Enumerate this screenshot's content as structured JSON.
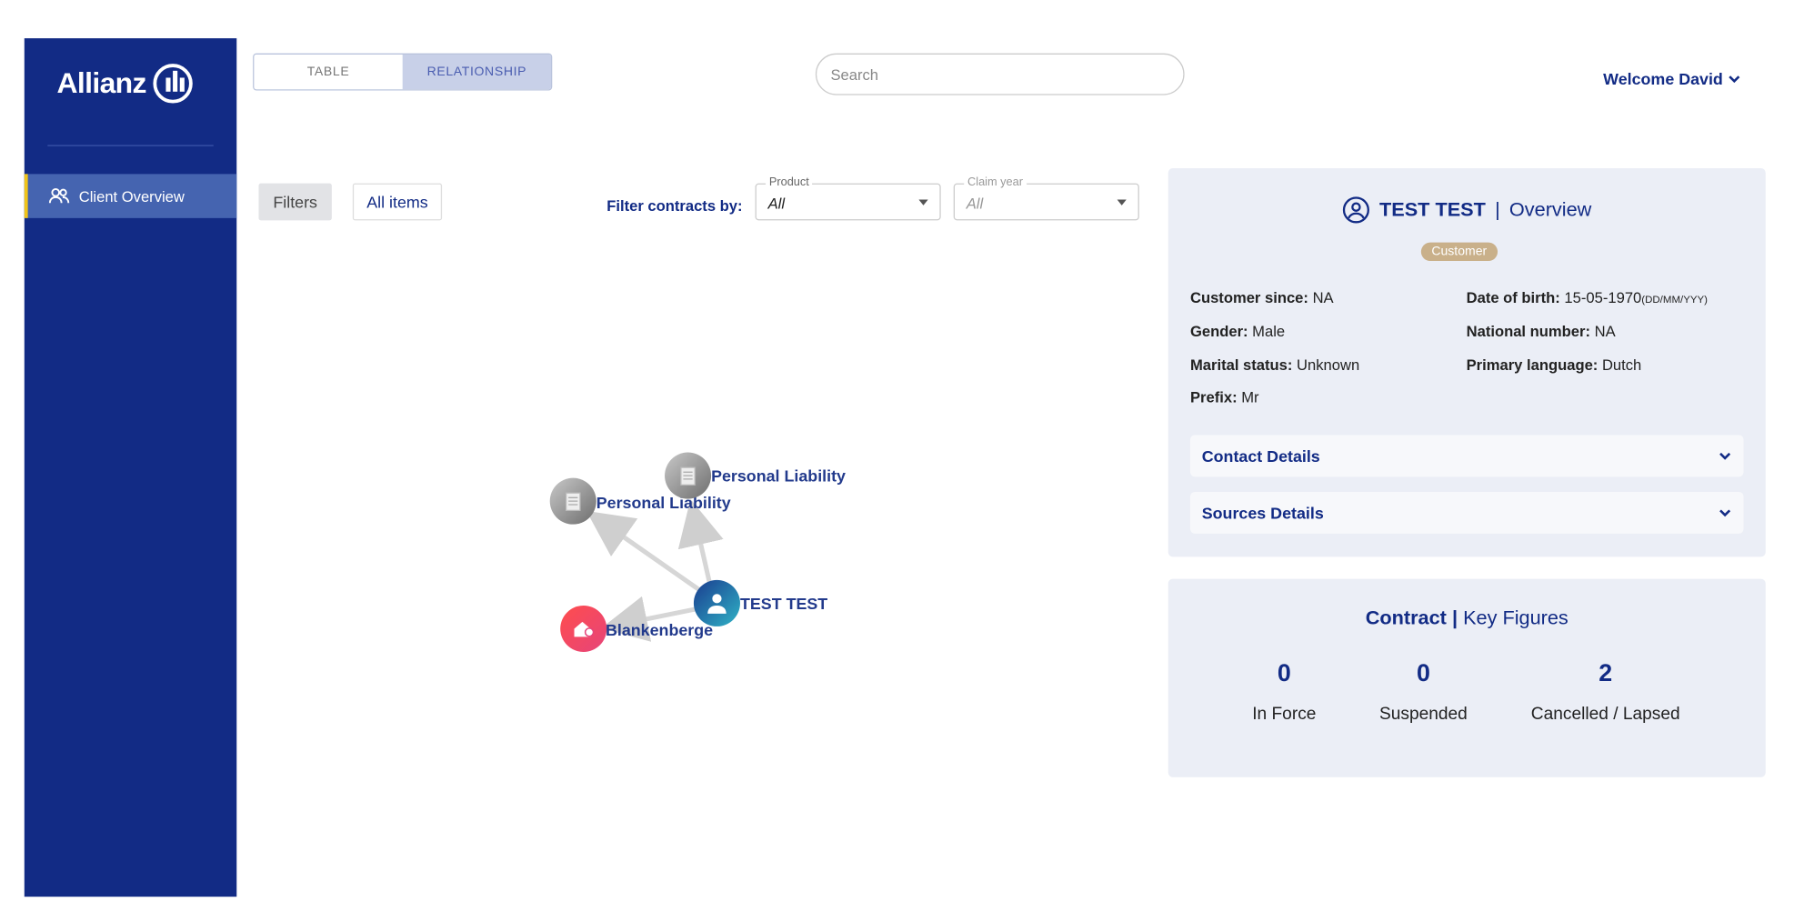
{
  "brand": {
    "name": "Allianz"
  },
  "sidebar": {
    "items": [
      {
        "label": "Client Overview",
        "icon": "users-icon"
      }
    ]
  },
  "view_tabs": [
    {
      "label": "TABLE",
      "active": false
    },
    {
      "label": "RELATIONSHIP",
      "active": true
    }
  ],
  "search": {
    "placeholder": "Search",
    "value": ""
  },
  "user_menu": {
    "label": "Welcome David"
  },
  "filters": {
    "filters_button": "Filters",
    "all_items_button": "All items",
    "filter_by_label": "Filter contracts by:",
    "product": {
      "label": "Product",
      "value": "All"
    },
    "claim_year": {
      "label": "Claim year",
      "value": "All"
    }
  },
  "graph": {
    "nodes": [
      {
        "label": "Personal Liability",
        "type": "contract"
      },
      {
        "label": "Personal Liability",
        "type": "contract"
      },
      {
        "label": "TEST TEST",
        "type": "person"
      },
      {
        "label": "Blankenberge",
        "type": "address"
      }
    ]
  },
  "overview": {
    "name": "TEST TEST",
    "separator": "|",
    "section": "Overview",
    "badge": "Customer",
    "fields": {
      "customer_since": {
        "label": "Customer since:",
        "value": "NA"
      },
      "gender": {
        "label": "Gender:",
        "value": "Male"
      },
      "marital_status": {
        "label": "Marital status:",
        "value": "Unknown"
      },
      "prefix": {
        "label": "Prefix:",
        "value": "Mr"
      },
      "date_of_birth": {
        "label": "Date of birth:",
        "value": "15-05-1970",
        "format": "(DD/MM/YYY)"
      },
      "national_number": {
        "label": "National number:",
        "value": "NA"
      },
      "primary_language": {
        "label": "Primary language:",
        "value": "Dutch"
      }
    },
    "accordions": [
      {
        "label": "Contact Details"
      },
      {
        "label": "Sources Details"
      }
    ]
  },
  "key_figures": {
    "title_bold": "Contract",
    "separator": "|",
    "title_rest": "Key Figures",
    "items": [
      {
        "value": "0",
        "label": "In Force"
      },
      {
        "value": "0",
        "label": "Suspended"
      },
      {
        "value": "2",
        "label": "Cancelled / Lapsed"
      }
    ]
  },
  "colors": {
    "brand_blue": "#122b85",
    "sidebar_active": "#4564b0",
    "accent_yellow": "#f0c419",
    "panel_bg": "#ebeef6",
    "badge": "#c9b08a"
  }
}
